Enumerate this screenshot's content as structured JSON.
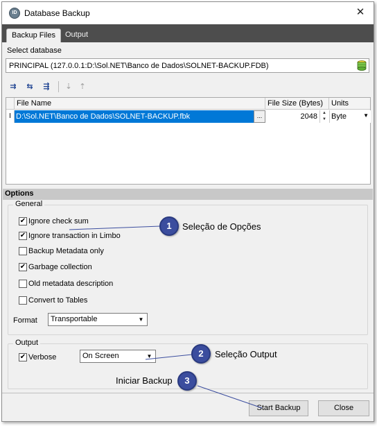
{
  "window": {
    "title": "Database Backup",
    "app_icon": "firebird-db-icon",
    "close_icon": "close-icon"
  },
  "tabs": [
    {
      "label": "Backup Files",
      "active": true
    },
    {
      "label": "Output",
      "active": false
    }
  ],
  "select_db": {
    "label": "Select database",
    "value": "PRINCIPAL (127.0.0.1:D:\\Sol.NET\\Banco de Dados\\SOLNET-BACKUP.FDB)",
    "icon": "database-icon"
  },
  "toolbar": {
    "icons": [
      "add-file-icon",
      "insert-file-icon",
      "append-file-icon",
      "move-down-icon",
      "move-up-icon"
    ]
  },
  "grid": {
    "columns": [
      "File Name",
      "File Size (Bytes)",
      "Units"
    ],
    "rows": [
      {
        "indicator": "I",
        "file": "D:\\Sol.NET\\Banco de Dados\\SOLNET-BACKUP.fbk",
        "ellipsis": "...",
        "size": "2048",
        "unit": "Byte"
      }
    ]
  },
  "options": {
    "header": "Options",
    "general_title": "General",
    "checks": [
      {
        "label": "Ignore check sum",
        "checked": true
      },
      {
        "label": "Ignore transaction in Limbo",
        "checked": true
      },
      {
        "label": "Backup Metadata only",
        "checked": false
      },
      {
        "label": "Garbage collection",
        "checked": true
      },
      {
        "label": "Old metadata description",
        "checked": false
      },
      {
        "label": "Convert to Tables",
        "checked": false
      }
    ],
    "format_label": "Format",
    "format_value": "Transportable"
  },
  "output": {
    "title": "Output",
    "verbose_label": "Verbose",
    "verbose_checked": true,
    "mode_value": "On Screen"
  },
  "buttons": {
    "start": "Start Backup",
    "close": "Close"
  },
  "callouts": [
    {
      "num": "1",
      "text": "Seleção de Opções"
    },
    {
      "num": "2",
      "text": "Seleção Output"
    },
    {
      "num": "3",
      "text": "Iniciar Backup"
    }
  ],
  "colors": {
    "selection": "#0078d7",
    "callout": "#3b4d9e",
    "tab_strip": "#4d4d4d"
  }
}
